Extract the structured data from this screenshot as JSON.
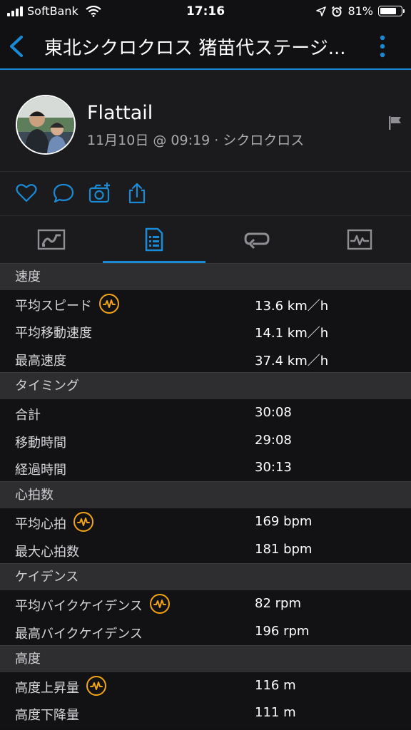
{
  "status_bar": {
    "carrier": "SoftBank",
    "time": "17:16",
    "battery": "81%",
    "battery_level": 0.81
  },
  "nav": {
    "title": "東北シクロクロス 猪苗代ステージ..."
  },
  "profile": {
    "name": "Flattail",
    "subtitle": "11月10日 @ 09:19 · シクロクロス"
  },
  "actions": [
    "heart-icon",
    "comment-icon",
    "camera-add-icon",
    "share-icon"
  ],
  "tabs": {
    "icons": [
      "map-icon",
      "details-icon",
      "laps-icon",
      "chart-icon"
    ],
    "active_index": 1
  },
  "colors": {
    "accent": "#1a8ad4",
    "badge": "#f2a413",
    "background": "#111113"
  },
  "sections": [
    {
      "title": "速度",
      "rows": [
        {
          "label": "平均スピード",
          "value": "13.6 km／h",
          "badge": true
        },
        {
          "label": "平均移動速度",
          "value": "14.1 km／h",
          "badge": false
        },
        {
          "label": "最高速度",
          "value": "37.4 km／h",
          "badge": false
        }
      ]
    },
    {
      "title": "タイミング",
      "rows": [
        {
          "label": "合計",
          "value": "30:08",
          "badge": false
        },
        {
          "label": "移動時間",
          "value": "29:08",
          "badge": false
        },
        {
          "label": "経過時間",
          "value": "30:13",
          "badge": false
        }
      ]
    },
    {
      "title": "心拍数",
      "rows": [
        {
          "label": "平均心拍",
          "value": "169 bpm",
          "badge": true
        },
        {
          "label": "最大心拍数",
          "value": "181 bpm",
          "badge": false
        }
      ]
    },
    {
      "title": "ケイデンス",
      "rows": [
        {
          "label": "平均バイクケイデンス",
          "value": "82 rpm",
          "badge": true
        },
        {
          "label": "最高バイクケイデンス",
          "value": "196 rpm",
          "badge": false
        }
      ]
    },
    {
      "title": "高度",
      "rows": [
        {
          "label": "高度上昇量",
          "value": "116 m",
          "badge": true
        },
        {
          "label": "高度下降量",
          "value": "111 m",
          "badge": false
        }
      ]
    }
  ]
}
